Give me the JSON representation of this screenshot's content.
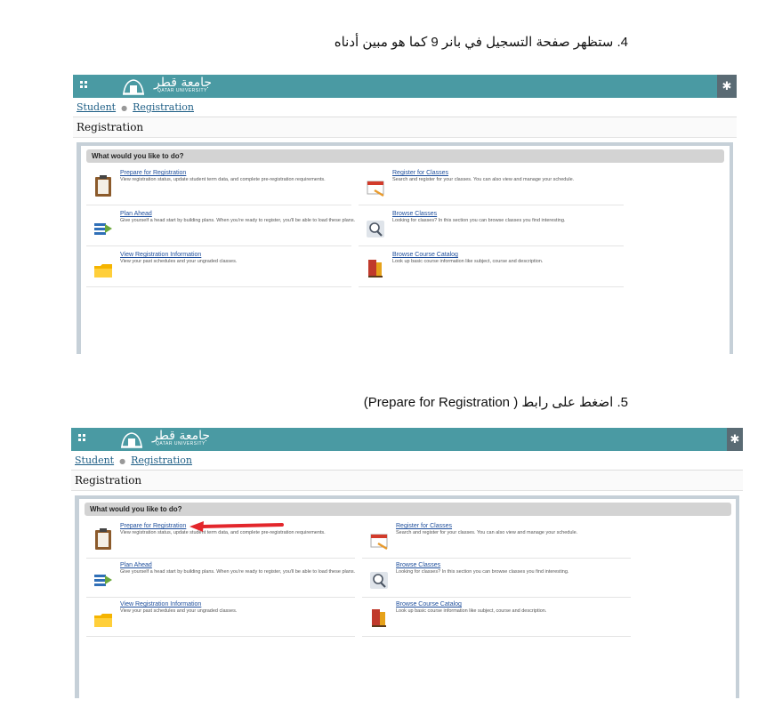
{
  "steps": [
    {
      "caption": "4. ستظهر صفحة التسجيل في بانر 9 كما هو مبين أدناه"
    },
    {
      "caption": "5. اضغط على رابط ( Prepare for Registration)"
    }
  ],
  "app": {
    "logo_arabic": "جامعة قطر",
    "logo_english": "QATAR UNIVERSITY",
    "breadcrumb": [
      "Student",
      "Registration"
    ],
    "page_title": "Registration",
    "prompt": "What would you like to do?",
    "accent_color": "#4a9aa3",
    "actions": [
      {
        "title": "Prepare for Registration",
        "description": "View registration status, update student term data, and complete pre-registration requirements.",
        "icon": "clipboard-icon"
      },
      {
        "title": "Register for Classes",
        "description": "Search and register for your classes. You can also view and manage your schedule.",
        "icon": "calendar-pencil-icon"
      },
      {
        "title": "Plan Ahead",
        "description": "Give yourself a head start by building plans. When you're ready to register, you'll be able to load these plans.",
        "icon": "plan-arrow-icon"
      },
      {
        "title": "Browse Classes",
        "description": "Looking for classes? In this section you can browse classes you find interesting.",
        "icon": "magnifier-icon"
      },
      {
        "title": "View Registration Information",
        "description": "View your past schedules and your ungraded classes.",
        "icon": "folder-icon"
      },
      {
        "title": "Browse Course Catalog",
        "description": "Look up basic course information like subject, course and description.",
        "icon": "books-icon"
      }
    ]
  }
}
